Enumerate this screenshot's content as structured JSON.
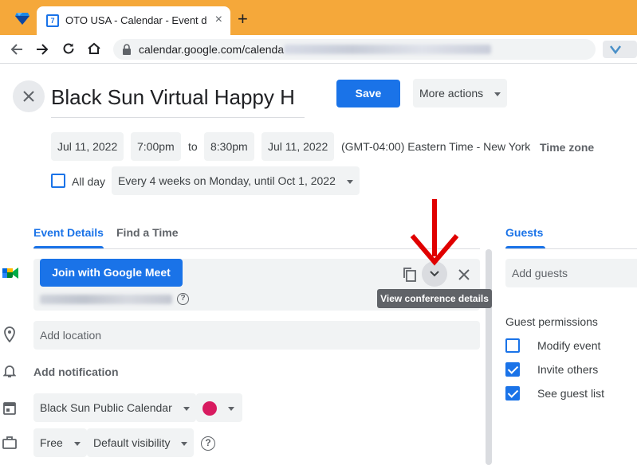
{
  "browser": {
    "tab_title": "OTO USA - Calendar - Event details",
    "tab_close": "×",
    "new_tab": "+",
    "url": "calendar.google.com/calenda"
  },
  "event": {
    "title": "Black Sun Virtual Happy H",
    "save_label": "Save",
    "more_actions_label": "More actions",
    "start_date": "Jul 11, 2022",
    "start_time": "7:00pm",
    "to_label": "to",
    "end_time": "8:30pm",
    "end_date": "Jul 11, 2022",
    "timezone_value": "(GMT-04:00) Eastern Time - New York",
    "timezone_button": "Time zone",
    "all_day_label": "All day",
    "recurrence": "Every 4 weeks on Monday, until Oct 1, 2022"
  },
  "tabs": {
    "event_details": "Event Details",
    "find_a_time": "Find a Time",
    "guests": "Guests"
  },
  "conference": {
    "join_label": "Join with Google Meet",
    "tooltip": "View conference details",
    "help_glyph": "?"
  },
  "details": {
    "location_placeholder": "Add location",
    "add_notification": "Add notification",
    "calendar_name": "Black Sun Public Calendar",
    "event_color": "#d81b60",
    "availability": "Free",
    "visibility": "Default visibility",
    "help_glyph": "?"
  },
  "guests": {
    "add_placeholder": "Add guests",
    "permissions_heading": "Guest permissions",
    "permissions": [
      {
        "label": "Modify event",
        "checked": false
      },
      {
        "label": "Invite others",
        "checked": true
      },
      {
        "label": "See guest list",
        "checked": true
      }
    ]
  },
  "colors": {
    "accent": "#1a73e8",
    "browser_frame": "#f5a83a",
    "annotation_arrow": "#e00000"
  }
}
